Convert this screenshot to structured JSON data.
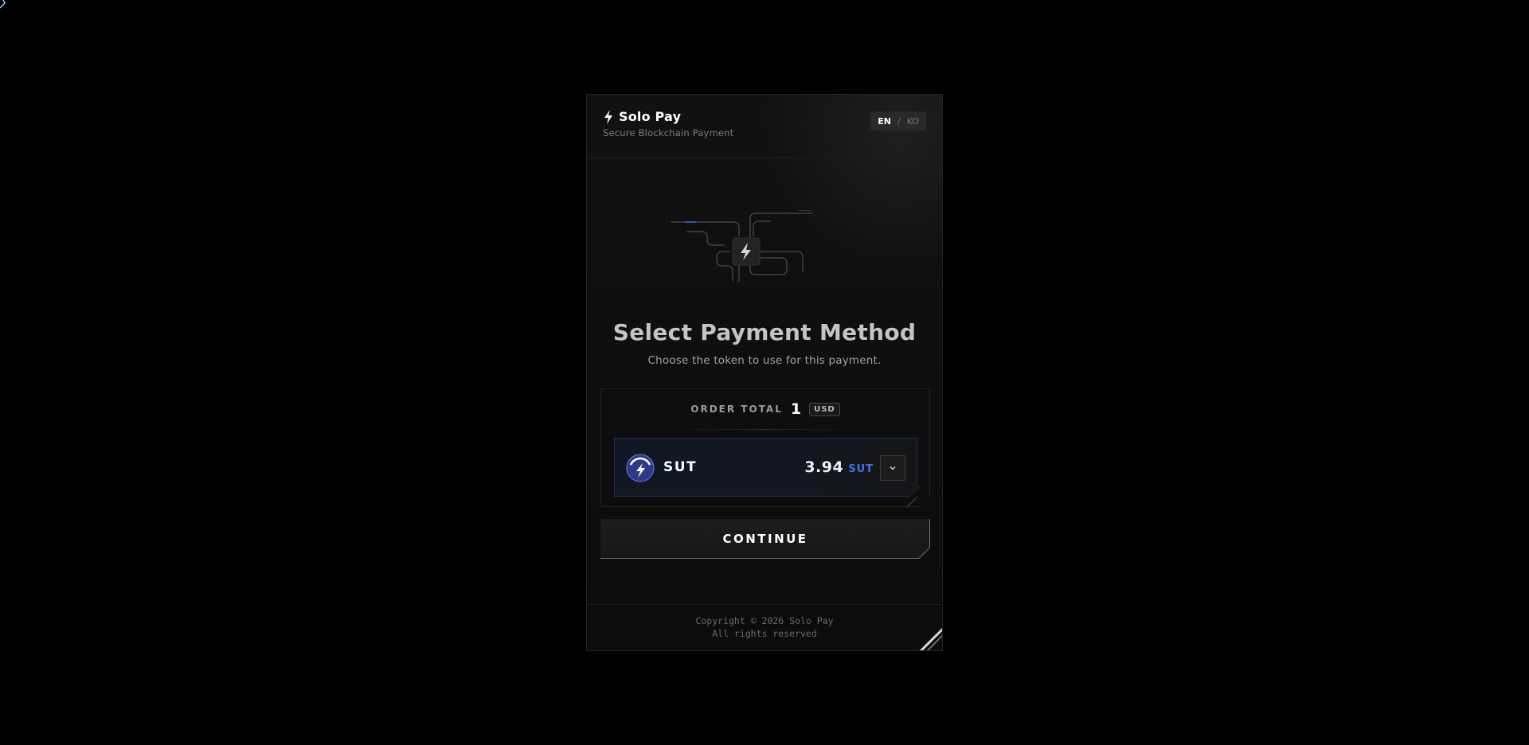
{
  "brand": {
    "name": "Solo Pay",
    "subtitle": "Secure Blockchain Payment",
    "icon": "lightning-bolt-icon"
  },
  "language": {
    "active": "EN",
    "separator": "/",
    "inactive": "KO"
  },
  "main": {
    "title": "Select Payment Method",
    "subtitle": "Choose the token to use for this payment."
  },
  "order": {
    "label": "ORDER TOTAL",
    "amount": "1",
    "currency": "USD"
  },
  "token": {
    "name": "SUT",
    "amount": "3.94",
    "symbol": "SUT",
    "icon": "sut-token-icon",
    "accent_color": "#3f72e8"
  },
  "actions": {
    "continue_label": "CONTINUE"
  },
  "footer": {
    "copyright": "Copyright © 2026 Solo Pay",
    "rights": "All rights reserved"
  },
  "colors": {
    "background": "#000000",
    "card": "#111111",
    "accent": "#3f72e8"
  }
}
